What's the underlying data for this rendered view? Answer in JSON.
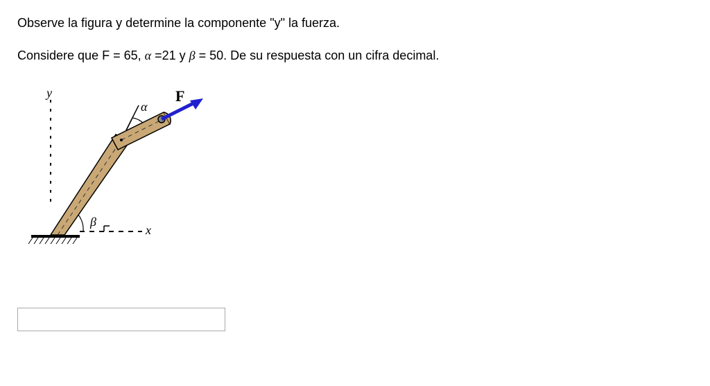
{
  "question": {
    "line1": "Observe la figura y determine la componente \"y\" la fuerza.",
    "line2_prefix": "Considere que F = ",
    "F_value": "65",
    "line2_mid1": ", ",
    "alpha_sym": "α",
    "line2_mid2": " =",
    "alpha_value": "21",
    "line2_mid3": "  y ",
    "beta_sym": "β",
    "line2_mid4": " = ",
    "beta_value": "50",
    "line2_suffix": ".  De su respuesta con un cifra decimal."
  },
  "labels": {
    "y": "y",
    "x": "x",
    "alpha": "α",
    "beta": "β",
    "F": "F"
  },
  "answer_placeholder": ""
}
